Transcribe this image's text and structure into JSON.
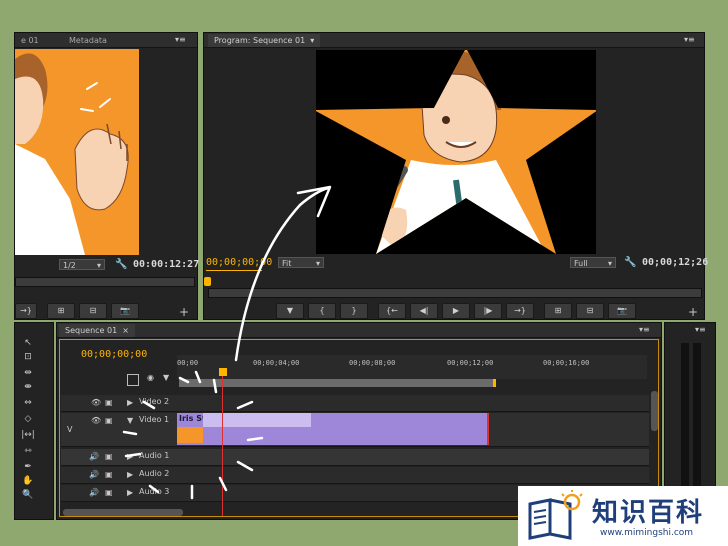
{
  "source_monitor": {
    "tab_left": "e 01",
    "tab_metadata": "Metadata",
    "zoom": "1/2",
    "timecode": "00:00:12:27"
  },
  "program_monitor": {
    "tab": "Program: Sequence 01",
    "timecode_current": "00;00;00;00",
    "fit": "Fit",
    "quality": "Full",
    "timecode_duration": "00;00;12;26"
  },
  "timeline": {
    "tab": "Sequence 01",
    "timecode": "00;00;00;00",
    "ruler": [
      "00;00",
      "00;00;04;00",
      "00;00;08;00",
      "00;00;12;00",
      "00;00;16;00"
    ],
    "side_label": "V",
    "tracks": {
      "video2": "Video 2",
      "video1": "Video 1",
      "audio1": "Audio 1",
      "audio2": "Audio 2",
      "audio3": "Audio 3"
    },
    "clip_name": "Iris Star"
  },
  "watermark": {
    "title": "知识百科",
    "url": "www.mimingshi.com"
  },
  "colors": {
    "background": "#8fa870",
    "timecode_orange": "#ffb400",
    "clip_purple": "#9e86d8",
    "playhead_red": "#e03030",
    "watermark_blue": "#1f3f7a"
  }
}
